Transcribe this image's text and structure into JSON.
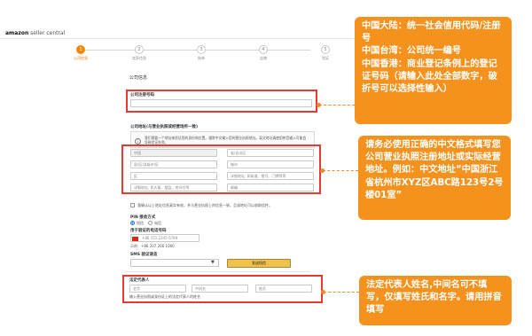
{
  "header": {
    "logo_brand": "amazon",
    "logo_sub": " seller central"
  },
  "progress": {
    "steps": [
      {
        "num": "1",
        "label": "公司信息"
      },
      {
        "num": "2",
        "label": "卖家信息"
      },
      {
        "num": "3",
        "label": "账单"
      },
      {
        "num": "4",
        "label": "店铺"
      },
      {
        "num": "5",
        "label": "验证"
      }
    ],
    "active_step": 1
  },
  "form": {
    "section_title": "公司信息",
    "reg_number_label": "公司注册号码",
    "reg_number_value": "",
    "address_label": "公司地址(与营业执照或经营场所一致)",
    "info_text": "我们需要一个地址来验证您的身份和位置。通常中文输入您的营业执照地址。英文地址请使用拼音输入可能会导致验证失败。",
    "country_value": "中国",
    "province_placeholder": "省/自治区",
    "district_placeholder": "县/区/县级市/区",
    "city_placeholder": "城市",
    "county_placeholder": "区",
    "street_placeholder": "详细地址, 如街道、楼号、门牌等等",
    "detail_placeholder": "详细地址, 如大厦、楼层、房间号等",
    "postal_placeholder": "邮编",
    "same_address_text": "我确认以上地址信息真实有效，并与营业执照上的信息一致，且该地址可以收取信件。",
    "pin_label": "PIN 接收方式",
    "pin_sms": "短信",
    "pin_call": "电话",
    "phone_label": "用于验证的电话号码",
    "phone_value": "+86 151 2345 6789",
    "phone_example": "示例：+86 207 266 1000",
    "sms_lang_label": "SMS 验证语言",
    "verify_button": "发送短信",
    "legal_rep_label": "法定代表人",
    "first_name_placeholder": "名字",
    "middle_name_placeholder": "中间名",
    "last_name_placeholder": "姓氏",
    "legal_rep_hint": "输入营业执照或身份证上的法定代表人的姓名"
  },
  "callouts": {
    "top": "中国大陆：统一社会信用代码/注册号\n中国台湾：公司统一编号\n中国香港：商业登记条例上的登记证号码（请输入此处全部数字，破折号可以选择性输入）",
    "middle": "请务必使用正确的中文格式填写您公司营业执照注册地址或实际经营地址。例如：中文地址“中国浙江省杭州市XYZ区ABC路123号2号楼01室”",
    "bottom": "法定代表人姓名,中间名可不填写，仅填写姓氏和名字。请用拼音填写"
  },
  "colors": {
    "callout_bg": "#f5921e",
    "highlight_border": "#e53935",
    "step_active": "#f08804",
    "verify_button": "#f0c14b"
  }
}
